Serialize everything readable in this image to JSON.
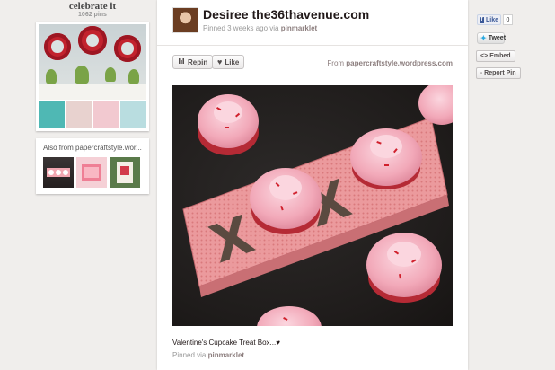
{
  "board": {
    "title": "celebrate it",
    "pin_count": "1062 pins"
  },
  "also_from": {
    "label": "Also from papercraftstyle.wor..."
  },
  "pin": {
    "pinner_name": "Desiree the36thavenue.com",
    "meta_prefix": "Pinned 3 weeks ago via ",
    "meta_source": "pinmarklet",
    "repin_label": "Repin",
    "like_label": "Like",
    "from_prefix": "From ",
    "from_domain": "papercraftstyle.wordpress.com",
    "description": "Valentine's Cupcake Treat Box...♥",
    "via_prefix": "Pinned via ",
    "via_source": "pinmarklet"
  },
  "share": {
    "fb_like_label": "Like",
    "fb_like_count": "0",
    "tweet_label": "Tweet",
    "embed_label": "Embed",
    "report_label": "Report Pin"
  },
  "icons": [
    "repin-icon",
    "heart-icon",
    "facebook-icon",
    "twitter-icon",
    "embed-icon",
    "flag-icon"
  ],
  "colors": {
    "accent": "#8c7e7e",
    "background": "#f0eeec",
    "facebook": "#3b5998",
    "twitter": "#2aa9e0"
  }
}
